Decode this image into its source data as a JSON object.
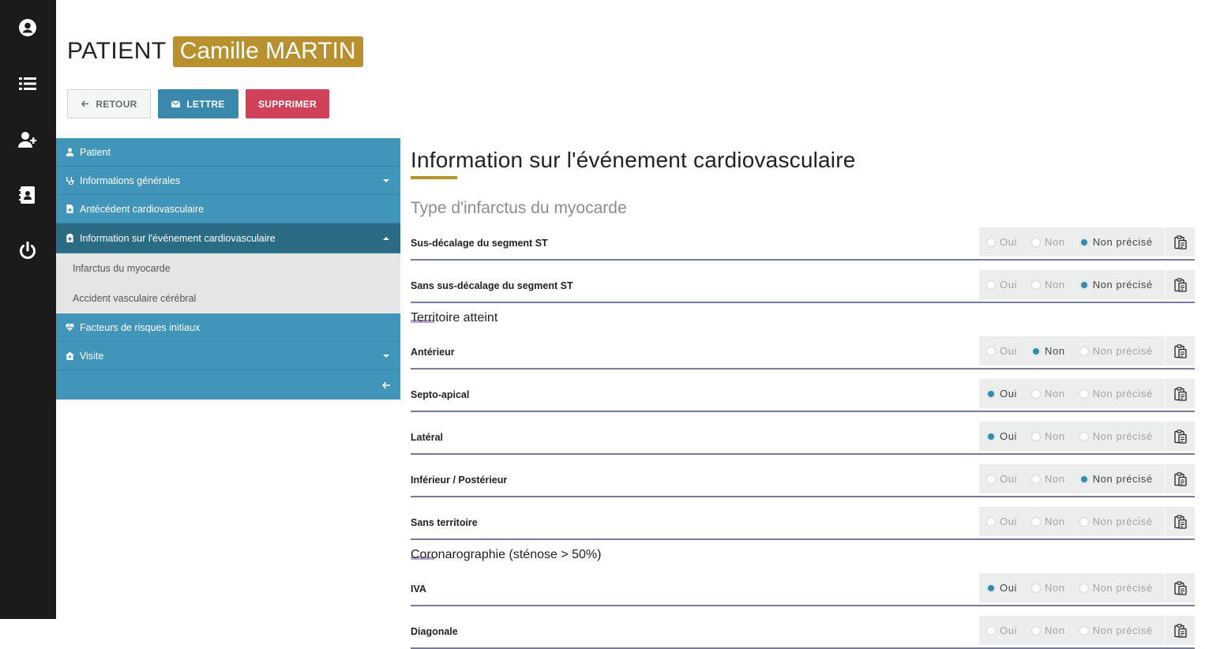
{
  "rail": {
    "icons": [
      "user-circle-icon",
      "list-icon",
      "user-plus-icon",
      "contact-book-icon",
      "power-icon"
    ]
  },
  "header": {
    "patient_label": "PATIENT",
    "patient_name": "Camille MARTIN"
  },
  "actions": {
    "back_label": "RETOUR",
    "letter_label": "LETTRE",
    "delete_label": "SUPPRIMER"
  },
  "menu": {
    "items": [
      {
        "label": "Patient",
        "icon": "user-icon"
      },
      {
        "label": "Informations générales",
        "icon": "stethoscope-icon"
      },
      {
        "label": "Antécédent cardiovasculaire",
        "icon": "file-medical-icon"
      },
      {
        "label": "Information sur l'événement cardiovasculaire",
        "icon": "notes-medical-icon"
      },
      {
        "label": "Facteurs de risques initiaux",
        "icon": "heartbeat-icon"
      },
      {
        "label": "Visite",
        "icon": "clinic-icon"
      }
    ],
    "subitems": [
      "Infarctus du myocarde",
      "Accident vasculaire cérébral"
    ]
  },
  "content": {
    "title": "Information sur l'événement cardiovasculaire",
    "section_title": "Type d'infarctus du myocarde",
    "option_labels": [
      "Oui",
      "Non",
      "Non précisé"
    ],
    "rows_type": [
      {
        "label": "Sus-décalage du segment ST",
        "selected": "Non précisé"
      },
      {
        "label": "Sans sus-décalage du segment ST",
        "selected": "Non précisé"
      }
    ],
    "group_territoire": "Territoire atteint",
    "rows_territoire": [
      {
        "label": "Antérieur",
        "selected": "Non"
      },
      {
        "label": "Septo-apical",
        "selected": "Oui"
      },
      {
        "label": "Latéral",
        "selected": "Oui"
      },
      {
        "label": "Inférieur / Postérieur",
        "selected": "Non précisé"
      },
      {
        "label": "Sans territoire",
        "selected": ""
      }
    ],
    "group_corono": "Coronarographie (sténose > 50%)",
    "rows_corono": [
      {
        "label": "IVA",
        "selected": "Oui"
      },
      {
        "label": "Diagonale",
        "selected": ""
      }
    ]
  },
  "colors": {
    "accent_gold": "#b8902e",
    "menu_blue": "#4195ba",
    "menu_active": "#2a6b86",
    "delete_red": "#cf4257",
    "radio_selected": "#3b88ad"
  }
}
